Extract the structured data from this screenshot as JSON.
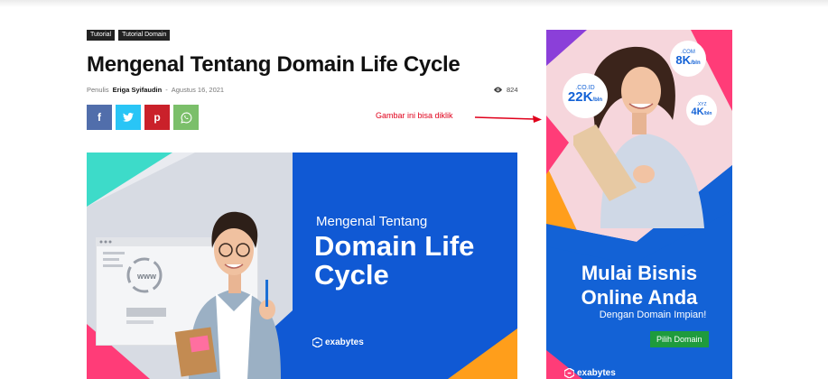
{
  "tags": [
    "Tutorial",
    "Tutorial Domain"
  ],
  "title": "Mengenal Tentang Domain Life Cycle",
  "meta": {
    "author_prefix": "Penulis",
    "author": "Eriga Syifaudin",
    "separator": "-",
    "date": "Agustus 16, 2021",
    "views": "824"
  },
  "share": {
    "facebook": "f",
    "twitter": "t",
    "pinterest": "p",
    "whatsapp": "w"
  },
  "note": "Gambar ini bisa diklik",
  "hero": {
    "line1": "Mengenal Tentang",
    "line2": "Domain Life Cycle",
    "browser_text": "www",
    "brand": "exabytes"
  },
  "ad": {
    "badges": [
      {
        "ext": ".COM",
        "price": "8K",
        "unit": "/bln"
      },
      {
        "ext": ".CO.ID",
        "price": "22K",
        "unit": "/bln"
      },
      {
        "ext": ".XYZ",
        "price": "4K",
        "unit": "/bln"
      }
    ],
    "headline1": "Mulai Bisnis",
    "headline2": "Online Anda",
    "subline": "Dengan Domain Impian!",
    "button": "Pilih Domain",
    "brand": "exabytes"
  },
  "colors": {
    "hero_blue": "#1059d4",
    "ad_blue": "#1362d6",
    "cyan": "#3ddbc9",
    "pink": "#ff3c78",
    "orange": "#ff9e1b",
    "purple": "#8b3fd9",
    "green_button": "#1e9b3d",
    "note_red": "#e0001b"
  }
}
